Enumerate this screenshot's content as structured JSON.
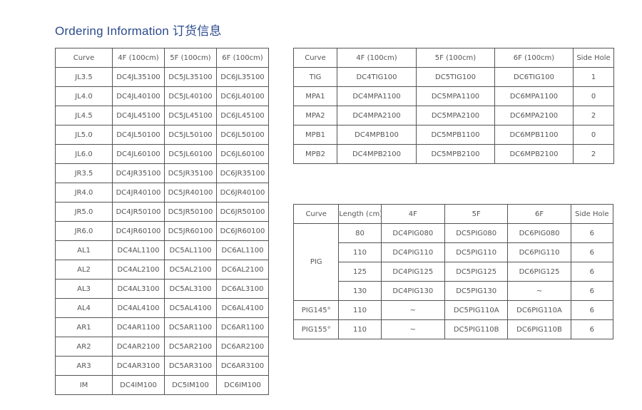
{
  "title": "Ordering Information 订货信息",
  "left_table": {
    "headers": [
      "Curve",
      "4F (100cm)",
      "5F (100cm)",
      "6F (100cm)"
    ],
    "rows": [
      [
        "JL3.5",
        "DC4JL35100",
        "DC5JL35100",
        "DC6JL35100"
      ],
      [
        "JL4.0",
        "DC4JL40100",
        "DC5JL40100",
        "DC6JL40100"
      ],
      [
        "JL4.5",
        "DC4JL45100",
        "DC5JL45100",
        "DC6JL45100"
      ],
      [
        "JL5.0",
        "DC4JL50100",
        "DC5JL50100",
        "DC6JL50100"
      ],
      [
        "JL6.0",
        "DC4JL60100",
        "DC5JL60100",
        "DC6JL60100"
      ],
      [
        "JR3.5",
        "DC4JR35100",
        "DC5JR35100",
        "DC6JR35100"
      ],
      [
        "JR4.0",
        "DC4JR40100",
        "DC5JR40100",
        "DC6JR40100"
      ],
      [
        "JR5.0",
        "DC4JR50100",
        "DC5JR50100",
        "DC6JR50100"
      ],
      [
        "JR6.0",
        "DC4JR60100",
        "DC5JR60100",
        "DC6JR60100"
      ],
      [
        "AL1",
        "DC4AL1100",
        "DC5AL1100",
        "DC6AL1100"
      ],
      [
        "AL2",
        "DC4AL2100",
        "DC5AL2100",
        "DC6AL2100"
      ],
      [
        "AL3",
        "DC4AL3100",
        "DC5AL3100",
        "DC6AL3100"
      ],
      [
        "AL4",
        "DC4AL4100",
        "DC5AL4100",
        "DC6AL4100"
      ],
      [
        "AR1",
        "DC4AR1100",
        "DC5AR1100",
        "DC6AR1100"
      ],
      [
        "AR2",
        "DC4AR2100",
        "DC5AR2100",
        "DC6AR2100"
      ],
      [
        "AR3",
        "DC4AR3100",
        "DC5AR3100",
        "DC6AR3100"
      ],
      [
        "IM",
        "DC4IM100",
        "DC5IM100",
        "DC6IM100"
      ]
    ]
  },
  "right_top_table": {
    "headers": [
      "Curve",
      "4F (100cm)",
      "5F (100cm)",
      "6F (100cm)",
      "Side Hole"
    ],
    "rows": [
      [
        "TIG",
        "DC4TIG100",
        "DC5TIG100",
        "DC6TIG100",
        "1"
      ],
      [
        "MPA1",
        "DC4MPA1100",
        "DC5MPA1100",
        "DC6MPA1100",
        "0"
      ],
      [
        "MPA2",
        "DC4MPA2100",
        "DC5MPA2100",
        "DC6MPA2100",
        "2"
      ],
      [
        "MPB1",
        "DC4MPB100",
        "DC5MPB1100",
        "DC6MPB1100",
        "0"
      ],
      [
        "MPB2",
        "DC4MPB2100",
        "DC5MPB2100",
        "DC6MPB2100",
        "2"
      ]
    ]
  },
  "right_bottom_table": {
    "headers": [
      "Curve",
      "Length (cm)",
      "4F",
      "5F",
      "6F",
      "Side Hole"
    ],
    "pig_group": {
      "curve": "PIG",
      "rows": [
        [
          "80",
          "DC4PIG080",
          "DC5PIG080",
          "DC6PIG080",
          "6"
        ],
        [
          "110",
          "DC4PIG110",
          "DC5PIG110",
          "DC6PIG110",
          "6"
        ],
        [
          "125",
          "DC4PIG125",
          "DC5PIG125",
          "DC6PIG125",
          "6"
        ],
        [
          "130",
          "DC4PIG130",
          "DC5PIG130",
          "~",
          "6"
        ]
      ]
    },
    "rows": [
      [
        "PIG145°",
        "110",
        "~",
        "DC5PIG110A",
        "DC6PIG110A",
        "6"
      ],
      [
        "PIG155°",
        "110",
        "~",
        "DC5PIG110B",
        "DC6PIG110B",
        "6"
      ]
    ]
  }
}
